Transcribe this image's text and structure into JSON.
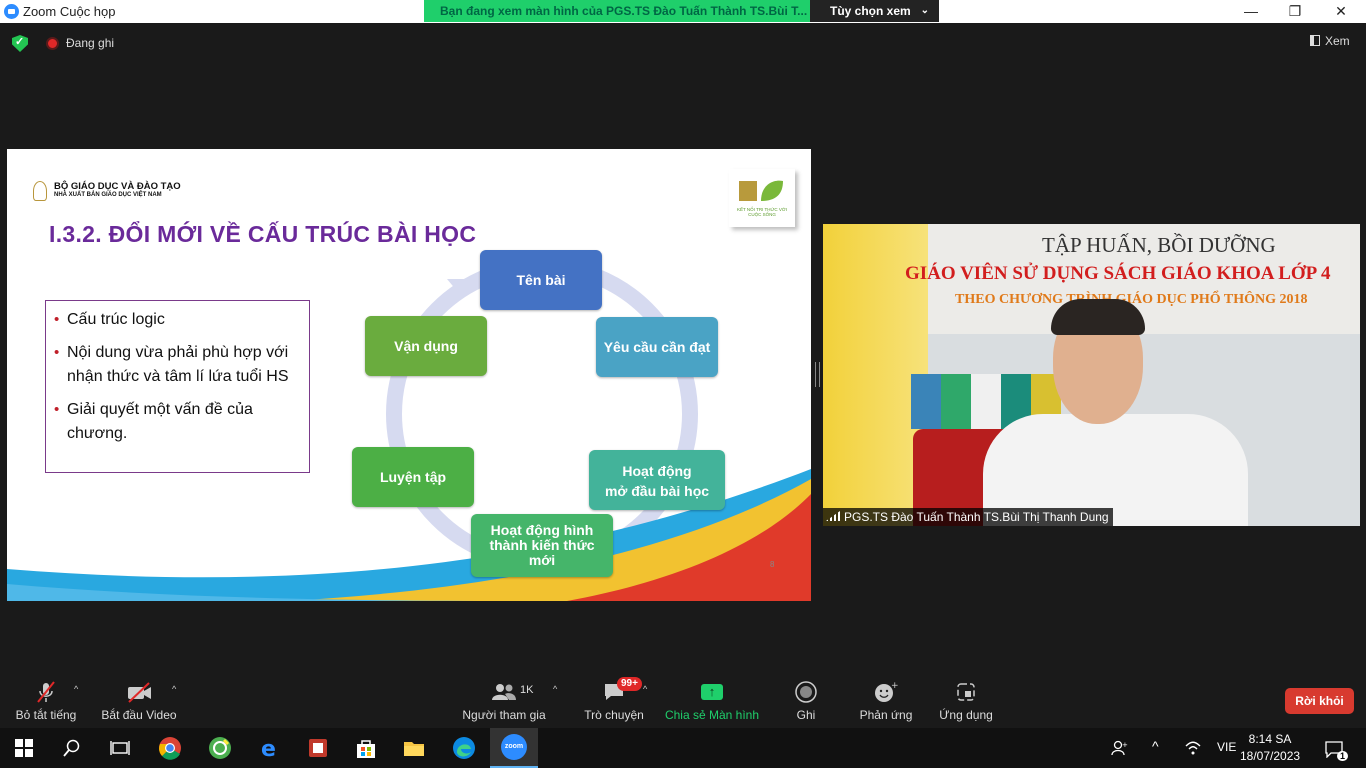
{
  "window": {
    "app_title": "Zoom Cuộc họp",
    "banner_text": "Bạn đang xem màn hình của PGS.TS Đào Tuấn Thành TS.Bùi T...",
    "view_options_label": "Tùy chọn xem",
    "minimize_glyph": "—",
    "restore_glyph": "❐",
    "close_glyph": "✕"
  },
  "top_bar": {
    "recording_label": "Đang ghi",
    "view_label": "Xem"
  },
  "slide": {
    "org_name": "BỘ GIÁO DỤC VÀ ĐÀO TẠO",
    "org_sub": "NHÀ XUẤT BẢN GIÁO DỤC VIỆT NAM",
    "brand_tagline": "KẾT NỐI TRI THỨC VỚI CUỘC SỐNG",
    "title": "I.3.2. ĐỔI MỚI VỀ CẤU TRÚC BÀI HỌC",
    "bullets": [
      "Cấu trúc logic",
      "Nội dung vừa phải phù hợp với nhận thức và tâm lí lứa tuổi HS",
      "Giải quyết một vấn đề của chương."
    ],
    "cycle_nodes": {
      "ten_bai": "Tên bài",
      "yeu_cau": "Yêu cầu cần đạt",
      "hd_mo_dau_1": "Hoạt động",
      "hd_mo_dau_2": "mở đầu bài học",
      "hd_hinh_thanh_1": "Hoạt động hình",
      "hd_hinh_thanh_2": "thành kiến thức",
      "hd_hinh_thanh_3": "mới",
      "luyen_tap": "Luyện tập",
      "van_dung": "Vận dụng"
    },
    "page_number": "8"
  },
  "video": {
    "banner_line1": "TẬP HUẤN, BỒI DƯỠNG",
    "banner_line2": "GIÁO VIÊN SỬ DỤNG SÁCH GIÁO KHOA LỚP 4",
    "banner_line3": "THEO CHƯƠNG TRÌNH GIÁO DỤC PHỔ THÔNG 2018",
    "participant_name": "PGS.TS Đào Tuấn Thành TS.Bùi Thị Thanh Dung"
  },
  "controls": {
    "mute_label": "Bỏ tắt tiếng",
    "video_label": "Bắt đầu Video",
    "participants_label": "Người tham gia",
    "participants_count": "1K",
    "chat_label": "Trò chuyện",
    "chat_badge": "99+",
    "share_label": "Chia sẻ Màn hình",
    "record_label": "Ghi",
    "reactions_label": "Phản ứng",
    "apps_label": "Ứng dụng",
    "leave_label": "Rời khỏi"
  },
  "taskbar": {
    "zoom_label": "zoom",
    "language": "VIE",
    "time": "8:14 SA",
    "date": "18/07/2023",
    "notification_count": "1"
  },
  "colors": {
    "share_green": "#1fcf6b",
    "leave_red": "#d83a2f",
    "title_purple": "#6a2a9a",
    "zoom_blue": "#2d8cff"
  }
}
